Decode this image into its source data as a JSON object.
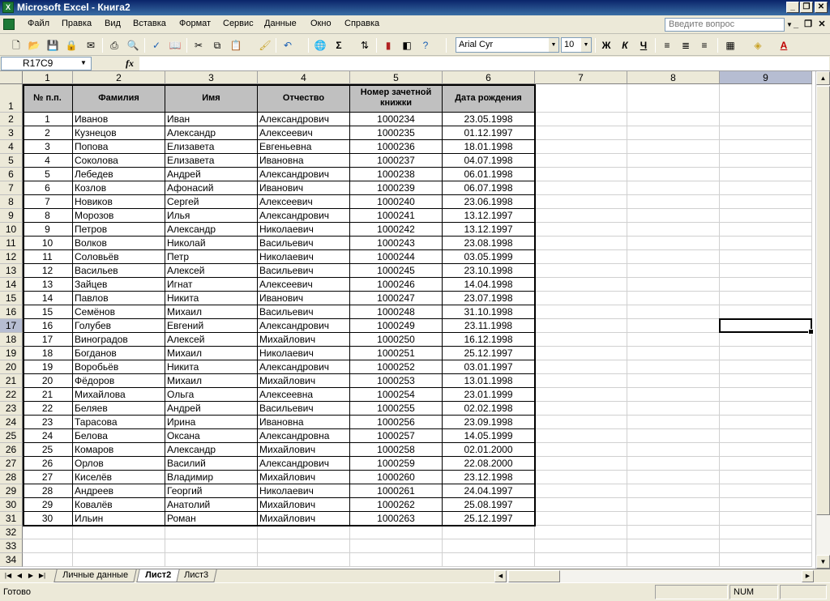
{
  "window": {
    "title": "Microsoft Excel - Книга2"
  },
  "menu": [
    "Файл",
    "Правка",
    "Вид",
    "Вставка",
    "Формат",
    "Сервис",
    "Данные",
    "Окно",
    "Справка"
  ],
  "help_placeholder": "Введите вопрос",
  "toolbar": {
    "font_name": "Arial Cyr",
    "font_size": "10",
    "bold": "Ж",
    "italic": "К",
    "underline": "Ч",
    "sum": "Σ"
  },
  "formula_bar": {
    "name_box": "R17C9",
    "fx": "fx",
    "formula": ""
  },
  "sheet": {
    "column_headers": [
      "1",
      "2",
      "3",
      "4",
      "5",
      "6",
      "7",
      "8",
      "9"
    ],
    "table_headers": [
      "№ п.п.",
      "Фамилия",
      "Имя",
      "Отчество",
      "Номер зачетной книжки",
      "Дата рождения"
    ],
    "rows": [
      [
        "1",
        "Иванов",
        "Иван",
        "Александрович",
        "1000234",
        "23.05.1998"
      ],
      [
        "2",
        "Кузнецов",
        "Александр",
        "Алексеевич",
        "1000235",
        "01.12.1997"
      ],
      [
        "3",
        " Попова",
        "Елизавета",
        "Евгеньевна",
        "1000236",
        "18.01.1998"
      ],
      [
        "4",
        "Соколова",
        "Елизавета",
        "Ивановна",
        "1000237",
        "04.07.1998"
      ],
      [
        "5",
        "Лебедев",
        "Андрей",
        "Александрович",
        "1000238",
        "06.01.1998"
      ],
      [
        "6",
        " Козлов",
        "Афонасий",
        "Иванович",
        "1000239",
        "06.07.1998"
      ],
      [
        "7",
        "Новиков",
        "Сергей",
        "Алексеевич",
        "1000240",
        "23.06.1998"
      ],
      [
        "8",
        "Морозов",
        "Илья",
        "Александрович",
        "1000241",
        "13.12.1997"
      ],
      [
        "9",
        "Петров",
        "Александр",
        "Николаевич",
        "1000242",
        "13.12.1997"
      ],
      [
        "10",
        "Волков",
        "Николай",
        "Васильевич",
        "1000243",
        "23.08.1998"
      ],
      [
        "11",
        "Соловьёв",
        "Петр",
        "Николаевич",
        "1000244",
        "03.05.1999"
      ],
      [
        "12",
        "Васильев",
        "Алексей",
        "Васильевич",
        "1000245",
        "23.10.1998"
      ],
      [
        "13",
        "Зайцев",
        "Игнат",
        "Алексеевич",
        "1000246",
        "14.04.1998"
      ],
      [
        "14",
        "Павлов",
        "Никита",
        "Иванович",
        "1000247",
        "23.07.1998"
      ],
      [
        "15",
        "Семёнов",
        "Михаил",
        "Васильевич",
        "1000248",
        "31.10.1998"
      ],
      [
        "16",
        "Голубев",
        "Евгений",
        "Александрович",
        "1000249",
        "23.11.1998"
      ],
      [
        "17",
        "Виноградов",
        "Алексей",
        "Михайлович",
        "1000250",
        "16.12.1998"
      ],
      [
        "18",
        "Богданов",
        "Михаил",
        "Николаевич",
        "1000251",
        "25.12.1997"
      ],
      [
        "19",
        "Воробьёв",
        "Никита",
        "Александрович",
        "1000252",
        "03.01.1997"
      ],
      [
        "20",
        "Фёдоров",
        "Михаил",
        "Михайлович",
        "1000253",
        "13.01.1998"
      ],
      [
        "21",
        "Михайлова",
        "Ольга",
        "Алексеевна",
        "1000254",
        "23.01.1999"
      ],
      [
        "22",
        "Беляев",
        "Андрей",
        "Васильевич",
        "1000255",
        "02.02.1998"
      ],
      [
        "23",
        "Тарасова",
        "Ирина",
        "Ивановна",
        "1000256",
        "23.09.1998"
      ],
      [
        "24",
        "Белова",
        "Оксана",
        "Александровна",
        "1000257",
        "14.05.1999"
      ],
      [
        "25",
        "Комаров",
        "Александр",
        "Михайлович",
        "1000258",
        "02.01.2000"
      ],
      [
        "26",
        "Орлов",
        "Василий",
        "Александрович",
        "1000259",
        "22.08.2000"
      ],
      [
        "27",
        "Киселёв",
        "Владимир",
        "Михайлович",
        "1000260",
        "23.12.1998"
      ],
      [
        "28",
        "Андреев",
        "Георгий",
        "Николаевич",
        "1000261",
        "24.04.1997"
      ],
      [
        "29",
        "Ковалёв",
        "Анатолий",
        "Михайлович",
        "1000262",
        "25.08.1997"
      ],
      [
        "30",
        "Ильин",
        "Роман",
        "Михайлович",
        "1000263",
        "25.12.1997"
      ]
    ],
    "row_numbers": [
      "1",
      "2",
      "3",
      "4",
      "5",
      "6",
      "7",
      "8",
      "9",
      "10",
      "11",
      "12",
      "13",
      "14",
      "15",
      "16",
      "17",
      "18",
      "19",
      "20",
      "21",
      "22",
      "23",
      "24",
      "25",
      "26",
      "27",
      "28",
      "29",
      "30",
      "31",
      "32",
      "33",
      "34"
    ],
    "selected_row": "17",
    "selected_col": "9"
  },
  "tabs": [
    "Личные данные",
    "Лист2",
    "Лист3"
  ],
  "active_tab": "Лист2",
  "status": {
    "text": "Готово",
    "num": "NUM"
  }
}
